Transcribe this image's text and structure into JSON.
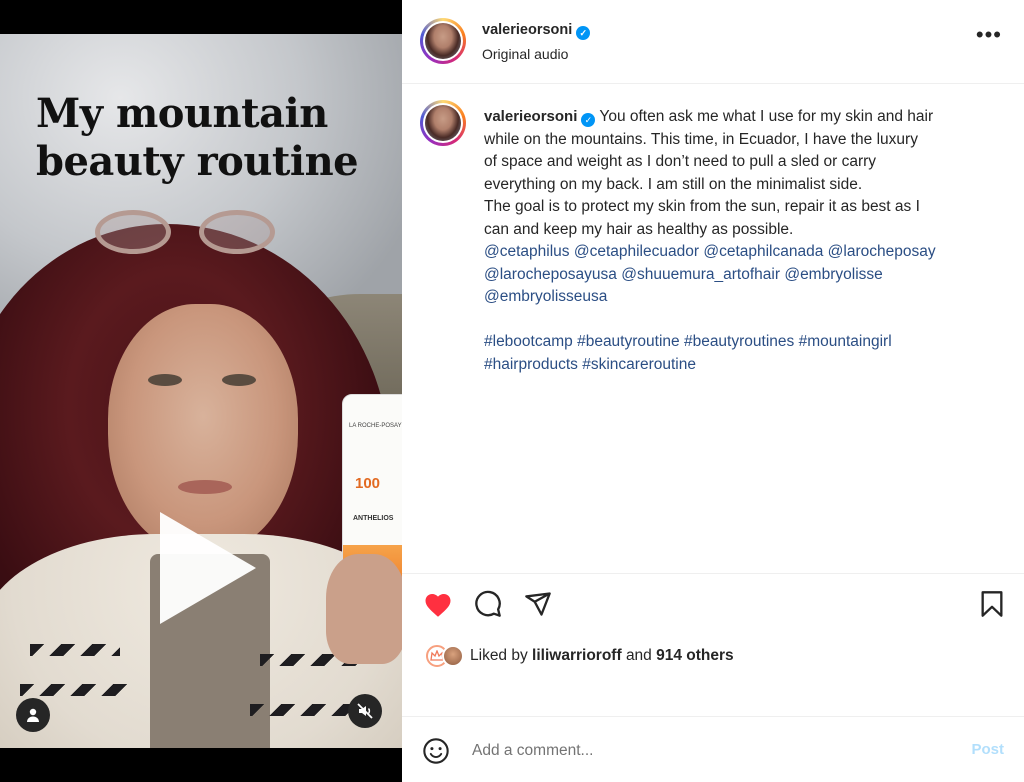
{
  "post": {
    "username": "valerieorsoni",
    "audio": "Original audio",
    "more_icon": "more-options-icon"
  },
  "media": {
    "overlay_line1": "My mountain",
    "overlay_line2": "beauty routine",
    "tube_brand": "LA ROCHE-POSAY",
    "tube_number": "100",
    "tube_name": "ANTHELIOS"
  },
  "caption": {
    "username": "valerieorsoni",
    "line1": "You often ask me what I use for my skin and hair",
    "line2": "while on the mountains. This time, in Ecuador, I have the luxury",
    "line3": "of space and weight as I don’t need to pull a sled or carry",
    "line4": "everything on my back. I am still on the minimalist side.",
    "line5": "The goal is to protect my skin from the sun, repair it as best as I",
    "line6": "can and keep my hair as healthy as possible.",
    "mentions": [
      "@cetaphilus",
      "@cetaphilecuador",
      "@cetaphilcanada",
      "@larocheposay",
      "@larocheposayusa",
      "@shuuemura_artofhair",
      "@embryolisse",
      "@embryolisseusa"
    ],
    "hashtags": [
      "#lebootcamp",
      "#beautyroutine",
      "#beautyroutines",
      "#mountaingirl",
      "#hairproducts",
      "#skincareroutine"
    ]
  },
  "likes": {
    "prefix": "Liked by",
    "user": "liliwarrioroff",
    "conj": "and",
    "others": "914 others"
  },
  "comment": {
    "placeholder": "Add a comment...",
    "post_label": "Post"
  },
  "colors": {
    "like_red": "#ff3040",
    "link_blue": "#2b4e84",
    "verified_blue": "#0095f6",
    "post_disabled": "#b2dffc"
  }
}
